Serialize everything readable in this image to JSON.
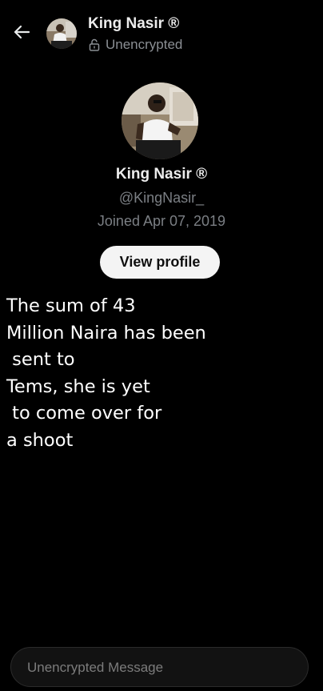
{
  "header": {
    "back_icon": "arrow-left-icon",
    "name": "King Nasir ®",
    "status_icon": "unlocked-lock-icon",
    "status": "Unencrypted"
  },
  "profile": {
    "name": "King Nasir ®",
    "handle": "@KingNasir_",
    "joined": "Joined Apr 07, 2019",
    "view_profile_label": "View profile"
  },
  "caption": {
    "lines": [
      "The sum of 43",
      "Million Naira has been",
      " sent to",
      "Tems, she is yet",
      " to come over for",
      "a shoot"
    ]
  },
  "composer": {
    "placeholder": "Unencrypted Message"
  },
  "colors": {
    "background": "#000000",
    "primary_text": "#ececec",
    "secondary_text": "#7b7f84",
    "button_bg": "#f4f4f4",
    "composer_bg": "#121212"
  }
}
